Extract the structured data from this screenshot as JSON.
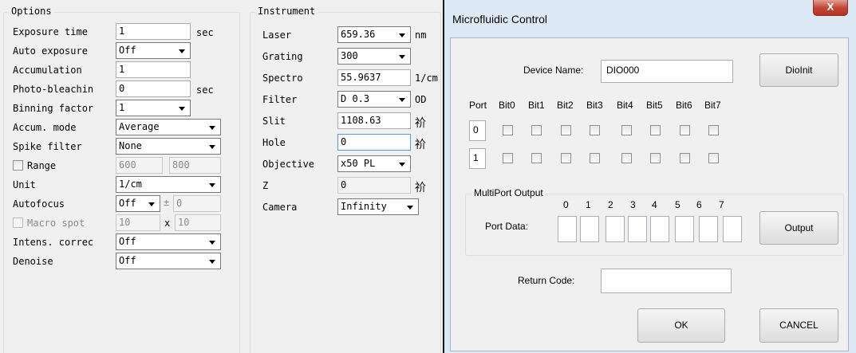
{
  "options": {
    "title": "Options",
    "rows": [
      {
        "label": "Exposure time",
        "value": "1",
        "unit": "sec"
      },
      {
        "label": "Auto exposure",
        "value": "Off"
      },
      {
        "label": "Accumulation",
        "value": "1"
      },
      {
        "label": "Photo-bleachin",
        "value": "0",
        "unit": "sec"
      },
      {
        "label": "Binning factor",
        "value": "1"
      },
      {
        "label": "Accum. mode",
        "value": "Average"
      },
      {
        "label": "Spike filter",
        "value": "None"
      },
      {
        "label": "Range",
        "value_from": "600",
        "value_to": "800"
      },
      {
        "label": "Unit",
        "value": "1/cm"
      },
      {
        "label": "Autofocus",
        "value": "Off",
        "plusminus": "±",
        "offset": "0"
      },
      {
        "label": "Macro spot",
        "value_x": "10",
        "x_sep": "x",
        "value_y": "10"
      },
      {
        "label": "Intens. correc",
        "value": "Off"
      },
      {
        "label": "Denoise",
        "value": "Off"
      }
    ]
  },
  "instrument": {
    "title": "Instrument",
    "rows": [
      {
        "label": "Laser",
        "value": "659.36",
        "unit": "nm"
      },
      {
        "label": "Grating",
        "value": "300"
      },
      {
        "label": "Spectro",
        "value": "55.9637",
        "unit": "1/cm"
      },
      {
        "label": "Filter",
        "value": "D 0.3",
        "unit": "OD"
      },
      {
        "label": "Slit",
        "value": "1108.63",
        "unit": "祄"
      },
      {
        "label": "Hole",
        "value": "0",
        "unit": "祄"
      },
      {
        "label": "Objective",
        "value": "x50 PL"
      },
      {
        "label": "Z",
        "value": "0",
        "unit": "祄"
      },
      {
        "label": "Camera",
        "value": "Infinity"
      }
    ]
  },
  "dialog": {
    "title": "Microfluidic Control",
    "close_label": "X",
    "device_name_label": "Device Name:",
    "device_name_value": "DIO000",
    "dioinit_label": "DioInit",
    "port_header": "Port",
    "bit_headers": [
      "Bit0",
      "Bit1",
      "Bit2",
      "Bit3",
      "Bit4",
      "Bit5",
      "Bit6",
      "Bit7"
    ],
    "ports": [
      "0",
      "1"
    ],
    "multiport_title": "MultiPort Output",
    "port_data_label": "Port Data:",
    "port_data_indices": [
      "0",
      "1",
      "2",
      "3",
      "4",
      "5",
      "6",
      "7"
    ],
    "output_label": "Output",
    "return_code_label": "Return Code:",
    "return_code_value": "",
    "ok_label": "OK",
    "cancel_label": "CANCEL"
  }
}
